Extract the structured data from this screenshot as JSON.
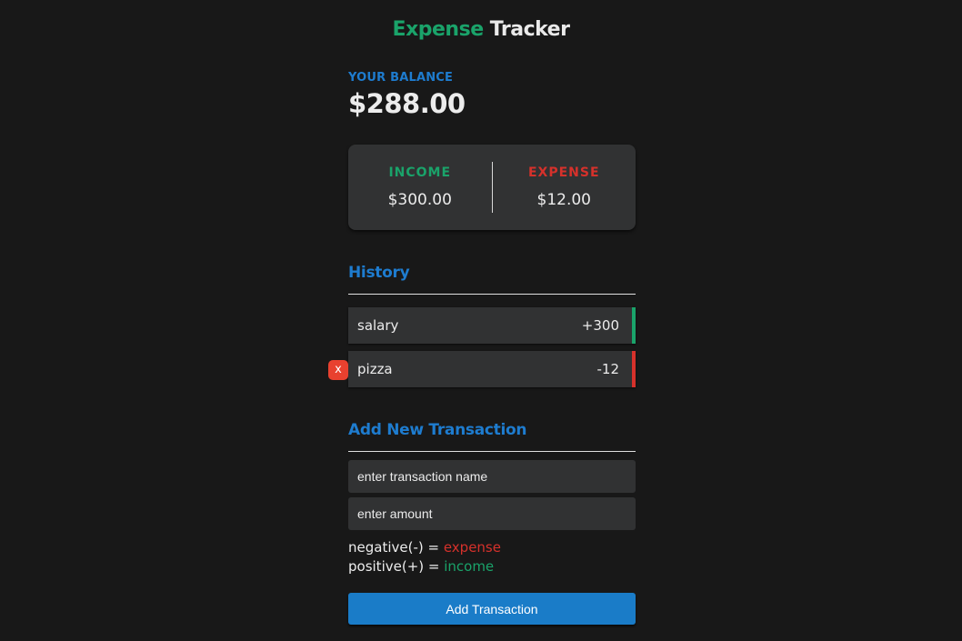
{
  "title": {
    "part1": "Expense",
    "part2": "Tracker"
  },
  "balance": {
    "label": "YOUR BALANCE",
    "value": "$288.00"
  },
  "summary": {
    "income_label": "INCOME",
    "income_value": "$300.00",
    "expense_label": "EXPENSE",
    "expense_value": "$12.00"
  },
  "history": {
    "title": "History",
    "items": [
      {
        "name": "salary",
        "amount": "+300",
        "type": "income"
      },
      {
        "name": "pizza",
        "amount": "-12",
        "type": "expense",
        "delete_label": "x"
      }
    ]
  },
  "add": {
    "title": "Add New Transaction",
    "name_placeholder": "enter transaction name",
    "amount_placeholder": "enter amount",
    "hint_neg_prefix": "negative(-) = ",
    "hint_neg_word": "expense",
    "hint_pos_prefix": "positive(+) = ",
    "hint_pos_word": "income",
    "button_label": "Add Transaction"
  },
  "colors": {
    "income": "#1aa36a",
    "expense": "#d6312b",
    "accent": "#1e7ccf",
    "background": "#181818"
  }
}
